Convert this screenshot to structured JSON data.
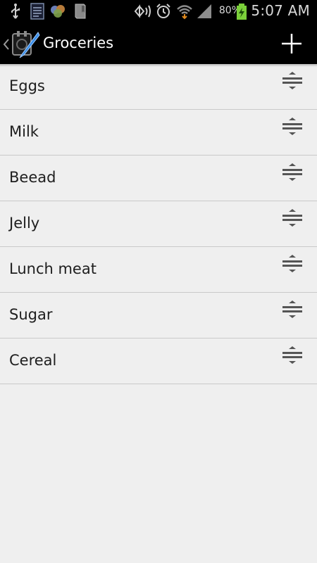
{
  "status_bar": {
    "battery_percent": "80%",
    "time": "5:07 AM",
    "icons": [
      "usb-icon",
      "document-icon",
      "app-notification-icon",
      "book-icon",
      "nfc-icon",
      "alarm-icon",
      "wifi-icon",
      "signal-icon",
      "battery-charging-icon"
    ]
  },
  "action_bar": {
    "title": "Groceries",
    "add_icon": "plus-icon",
    "app_icon": "notepad-pen-icon",
    "back_icon": "chevron-left-icon"
  },
  "list": {
    "items": [
      {
        "label": "Eggs"
      },
      {
        "label": "Milk"
      },
      {
        "label": "Beead"
      },
      {
        "label": "Jelly"
      },
      {
        "label": "Lunch meat"
      },
      {
        "label": "Sugar"
      },
      {
        "label": "Cereal"
      }
    ],
    "handle_icon": "drag-handle-icon"
  },
  "colors": {
    "bar_bg": "#000000",
    "list_bg": "#efefef",
    "divider": "#c9c9c9"
  }
}
